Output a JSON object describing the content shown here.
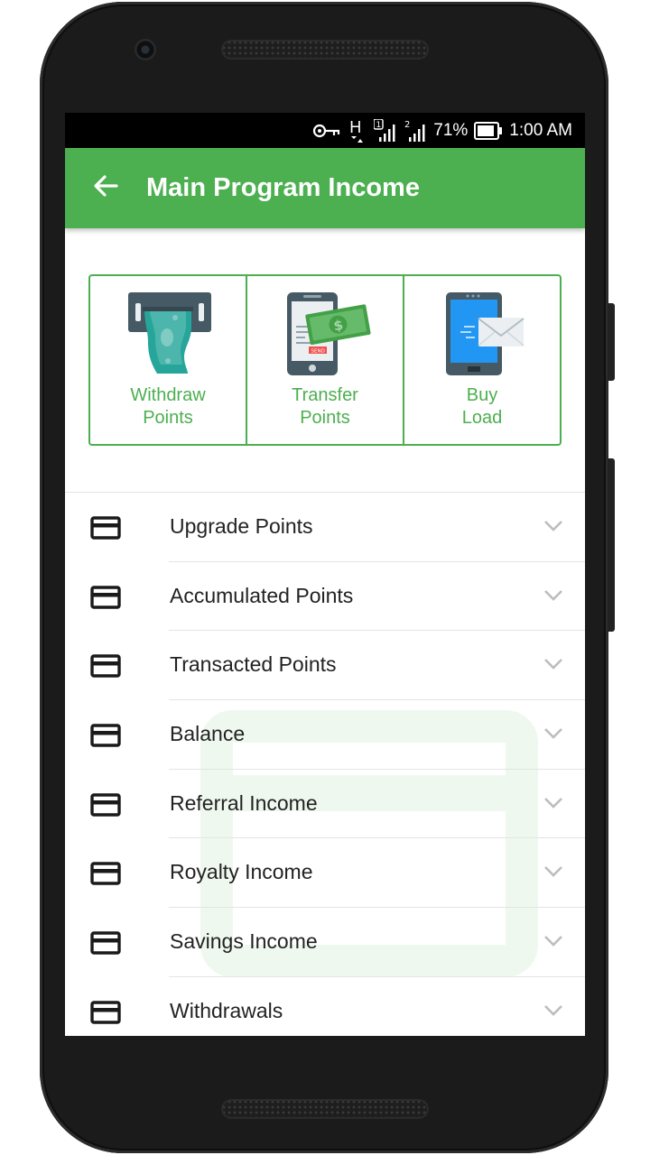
{
  "status_bar": {
    "network": "H",
    "battery_percent": "71%",
    "time": "1:00 AM",
    "icons": [
      "vpn-key-icon",
      "data-activity-icon",
      "signal-sim1-icon",
      "signal-sim2-icon",
      "battery-icon"
    ]
  },
  "app_bar": {
    "title": "Main Program Income",
    "back_icon": "arrow-back-icon",
    "color": "#4caf50"
  },
  "actions": [
    {
      "label": "Withdraw\nPoints",
      "icon": "atm-cash-icon"
    },
    {
      "label": "Transfer\nPoints",
      "icon": "phone-money-icon"
    },
    {
      "label": "Buy\nLoad",
      "icon": "phone-mail-icon"
    }
  ],
  "menu": [
    {
      "label": "Upgrade Points"
    },
    {
      "label": "Accumulated Points"
    },
    {
      "label": "Transacted Points"
    },
    {
      "label": "Balance"
    },
    {
      "label": "Referral Income"
    },
    {
      "label": "Royalty Income"
    },
    {
      "label": "Savings Income"
    },
    {
      "label": "Withdrawals"
    }
  ],
  "colors": {
    "accent": "#4caf50",
    "text": "#222222",
    "divider": "#e4e4e4"
  }
}
